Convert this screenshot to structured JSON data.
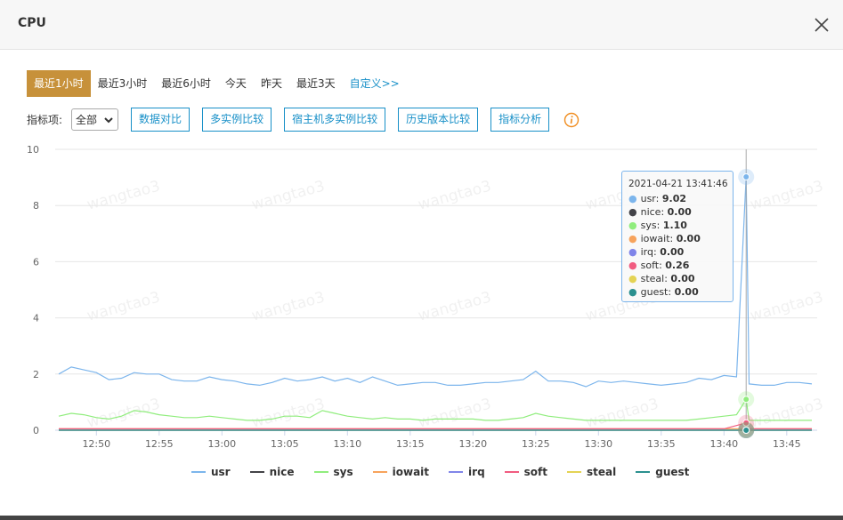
{
  "dialog": {
    "title": "CPU"
  },
  "time_tabs": [
    {
      "label": "最近1小时",
      "active": true
    },
    {
      "label": "最近3小时",
      "active": false
    },
    {
      "label": "最近6小时",
      "active": false
    },
    {
      "label": "今天",
      "active": false
    },
    {
      "label": "昨天",
      "active": false
    },
    {
      "label": "最近3天",
      "active": false
    },
    {
      "label": "自定义>>",
      "active": false
    }
  ],
  "toolbar": {
    "metric_label": "指标项:",
    "metric_select_value": "全部",
    "buttons": [
      "数据对比",
      "多实例比较",
      "宿主机多实例比较",
      "历史版本比较",
      "指标分析"
    ]
  },
  "watermark": "wangtao3",
  "tooltip": {
    "time": "2021-04-21 13:41:46",
    "rows": [
      {
        "name": "usr",
        "value": "9.02",
        "color": "#7cb5ec"
      },
      {
        "name": "nice",
        "value": "0.00",
        "color": "#434348"
      },
      {
        "name": "sys",
        "value": "1.10",
        "color": "#90ed7d"
      },
      {
        "name": "iowait",
        "value": "0.00",
        "color": "#f7a35c"
      },
      {
        "name": "irq",
        "value": "0.00",
        "color": "#8085e9"
      },
      {
        "name": "soft",
        "value": "0.26",
        "color": "#f15c80"
      },
      {
        "name": "steal",
        "value": "0.00",
        "color": "#e4d354"
      },
      {
        "name": "guest",
        "value": "0.00",
        "color": "#2b908f"
      }
    ]
  },
  "chart_data": {
    "type": "line",
    "ylim": [
      0,
      10
    ],
    "y_ticks": [
      "0",
      "2",
      "4",
      "6",
      "8",
      "10"
    ],
    "x_ticks": [
      "12:50",
      "12:55",
      "13:00",
      "13:05",
      "13:10",
      "13:15",
      "13:20",
      "13:25",
      "13:30",
      "13:35",
      "13:40",
      "13:45"
    ],
    "x_range": [
      "12:47",
      "13:47"
    ],
    "crosshair_x": "13:41:46",
    "grid": true,
    "legend_position": "bottom",
    "series": [
      {
        "name": "usr",
        "color": "#7cb5ec",
        "x": [
          "12:47",
          "12:48",
          "12:49",
          "12:50",
          "12:51",
          "12:52",
          "12:53",
          "12:54",
          "12:55",
          "12:56",
          "12:57",
          "12:58",
          "12:59",
          "13:00",
          "13:01",
          "13:02",
          "13:03",
          "13:04",
          "13:05",
          "13:06",
          "13:07",
          "13:08",
          "13:09",
          "13:10",
          "13:11",
          "13:12",
          "13:13",
          "13:14",
          "13:15",
          "13:16",
          "13:17",
          "13:18",
          "13:19",
          "13:20",
          "13:21",
          "13:22",
          "13:23",
          "13:24",
          "13:25",
          "13:26",
          "13:27",
          "13:28",
          "13:29",
          "13:30",
          "13:31",
          "13:32",
          "13:33",
          "13:34",
          "13:35",
          "13:36",
          "13:37",
          "13:38",
          "13:39",
          "13:40",
          "13:41",
          "13:41:46",
          "13:42",
          "13:43",
          "13:44",
          "13:45",
          "13:46",
          "13:47"
        ],
        "values": [
          2.0,
          2.25,
          2.15,
          2.05,
          1.8,
          1.85,
          2.05,
          2.0,
          2.0,
          1.8,
          1.75,
          1.75,
          1.9,
          1.8,
          1.75,
          1.65,
          1.6,
          1.7,
          1.85,
          1.75,
          1.8,
          1.9,
          1.75,
          1.85,
          1.7,
          1.9,
          1.75,
          1.6,
          1.65,
          1.7,
          1.7,
          1.6,
          1.6,
          1.65,
          1.7,
          1.7,
          1.75,
          1.8,
          2.1,
          1.75,
          1.75,
          1.7,
          1.55,
          1.75,
          1.7,
          1.75,
          1.7,
          1.65,
          1.6,
          1.65,
          1.7,
          1.85,
          1.8,
          1.95,
          1.9,
          9.02,
          1.65,
          1.6,
          1.6,
          1.7,
          1.7,
          1.65
        ]
      },
      {
        "name": "nice",
        "color": "#434348",
        "x": [
          "12:47",
          "13:47"
        ],
        "values": [
          0.0,
          0.0
        ]
      },
      {
        "name": "sys",
        "color": "#90ed7d",
        "x": [
          "12:47",
          "12:48",
          "12:49",
          "12:50",
          "12:51",
          "12:52",
          "12:53",
          "12:54",
          "12:55",
          "12:56",
          "12:57",
          "12:58",
          "12:59",
          "13:00",
          "13:01",
          "13:02",
          "13:03",
          "13:04",
          "13:05",
          "13:06",
          "13:07",
          "13:08",
          "13:09",
          "13:10",
          "13:11",
          "13:12",
          "13:13",
          "13:14",
          "13:15",
          "13:16",
          "13:17",
          "13:18",
          "13:19",
          "13:20",
          "13:21",
          "13:22",
          "13:23",
          "13:24",
          "13:25",
          "13:26",
          "13:27",
          "13:28",
          "13:29",
          "13:30",
          "13:31",
          "13:32",
          "13:33",
          "13:34",
          "13:35",
          "13:36",
          "13:37",
          "13:38",
          "13:39",
          "13:40",
          "13:41",
          "13:41:46",
          "13:42",
          "13:43",
          "13:44",
          "13:45",
          "13:46",
          "13:47"
        ],
        "values": [
          0.5,
          0.6,
          0.55,
          0.45,
          0.4,
          0.5,
          0.7,
          0.65,
          0.55,
          0.5,
          0.45,
          0.45,
          0.5,
          0.45,
          0.4,
          0.35,
          0.35,
          0.4,
          0.5,
          0.5,
          0.45,
          0.7,
          0.6,
          0.5,
          0.45,
          0.4,
          0.45,
          0.4,
          0.4,
          0.35,
          0.4,
          0.4,
          0.4,
          0.4,
          0.35,
          0.35,
          0.4,
          0.45,
          0.6,
          0.5,
          0.45,
          0.4,
          0.35,
          0.35,
          0.35,
          0.35,
          0.35,
          0.35,
          0.35,
          0.35,
          0.35,
          0.4,
          0.45,
          0.5,
          0.55,
          1.1,
          0.35,
          0.35,
          0.35,
          0.35,
          0.35,
          0.35
        ]
      },
      {
        "name": "iowait",
        "color": "#f7a35c",
        "x": [
          "12:47",
          "13:47"
        ],
        "values": [
          0.05,
          0.05
        ]
      },
      {
        "name": "irq",
        "color": "#8085e9",
        "x": [
          "12:47",
          "13:47"
        ],
        "values": [
          0.0,
          0.0
        ]
      },
      {
        "name": "soft",
        "color": "#f15c80",
        "x": [
          "12:47",
          "13:40",
          "13:41:46",
          "13:42",
          "13:47"
        ],
        "values": [
          0.05,
          0.05,
          0.26,
          0.05,
          0.05
        ]
      },
      {
        "name": "steal",
        "color": "#e4d354",
        "x": [
          "12:47",
          "13:47"
        ],
        "values": [
          0.0,
          0.0
        ]
      },
      {
        "name": "guest",
        "color": "#2b908f",
        "x": [
          "12:47",
          "13:47"
        ],
        "values": [
          0.0,
          0.0
        ]
      }
    ]
  }
}
